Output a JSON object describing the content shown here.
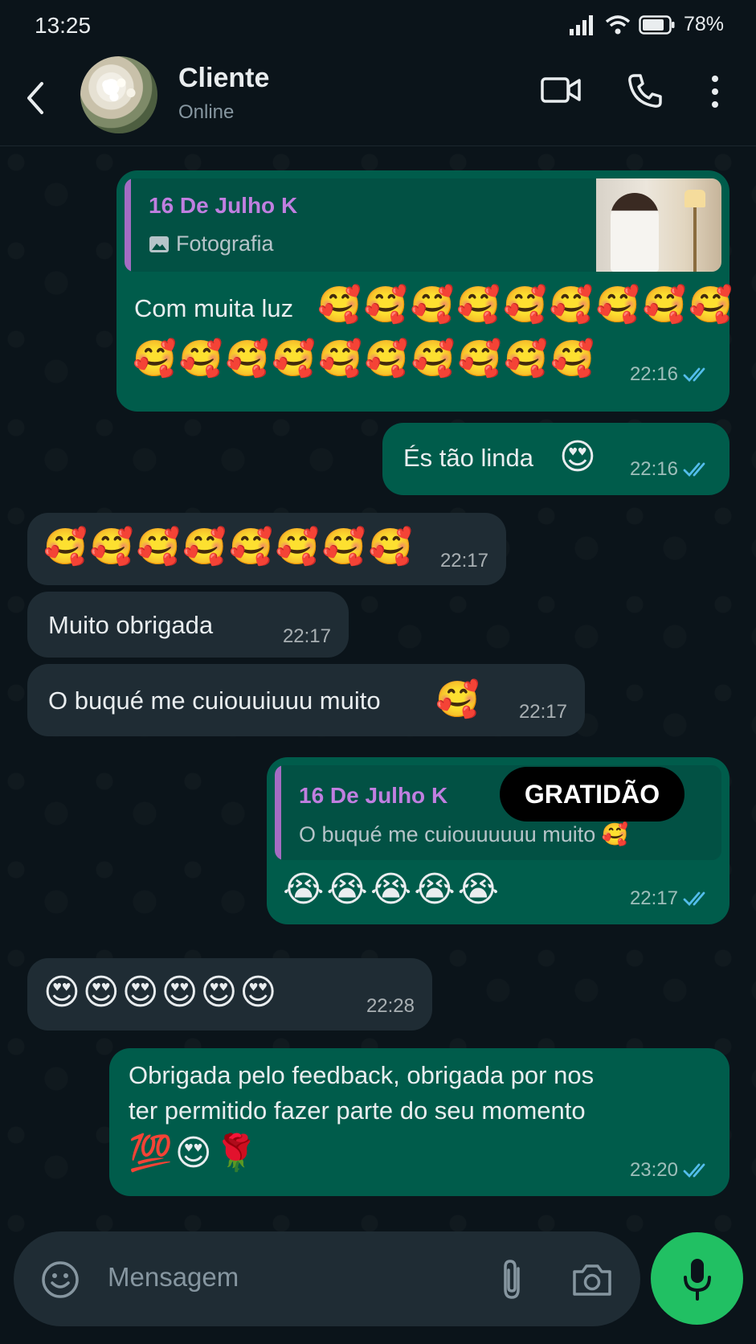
{
  "status_bar": {
    "time": "13:25",
    "battery": "78%"
  },
  "header": {
    "name": "Cliente",
    "status": "Online"
  },
  "messages": [
    {
      "quote": {
        "author": "16 De Julho K",
        "text": "Fotografia"
      },
      "text": "Com muita luz",
      "emoji_line1": "🥰🥰🥰🥰🥰🥰🥰🥰🥰",
      "emoji_line2": "🥰🥰🥰🥰🥰🥰🥰🥰🥰🥰",
      "time": "22:16"
    },
    {
      "text": "És tão linda",
      "emoji": "😍",
      "time": "22:16"
    },
    {
      "emoji": "🥰🥰🥰🥰🥰🥰🥰🥰",
      "time": "22:17"
    },
    {
      "text": "Muito obrigada",
      "time": "22:17"
    },
    {
      "text": "O buqué me cuiouuiuuu muito",
      "emoji": "🥰",
      "time": "22:17"
    },
    {
      "quote": {
        "author": "16 De Julho K",
        "text": "O buqué me cuiouuuuuu muito 🥰"
      },
      "emoji": "😭😭😭😭😭",
      "time": "22:17"
    },
    {
      "emoji": "😍😍😍😍😍😍",
      "time": "22:28"
    },
    {
      "line1": "Obrigada pelo feedback, obrigada por nos",
      "line2": "ter permitido fazer parte do seu momento",
      "emoji": "💯😍🌹",
      "time": "23:20"
    }
  ],
  "overlay_label": "GRATIDÃO",
  "composer": {
    "placeholder": "Mensagem"
  },
  "colors": {
    "background": "#0b141a",
    "outgoing_bubble": "#005c4b",
    "incoming_bubble": "#1f2c34",
    "read_ticks": "#53bdeb",
    "mic_button": "#21c063"
  }
}
